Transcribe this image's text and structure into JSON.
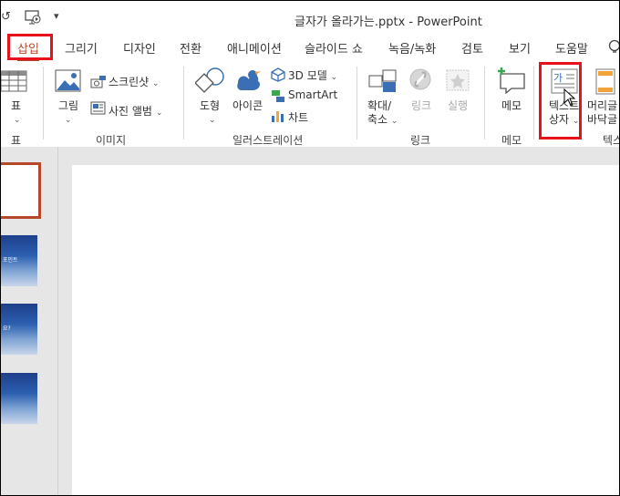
{
  "window": {
    "title": "글자가 올라가는.pptx  -  PowerPoint"
  },
  "tabs": [
    {
      "label": "삽입",
      "active": true
    },
    {
      "label": "그리기"
    },
    {
      "label": "디자인"
    },
    {
      "label": "전환"
    },
    {
      "label": "애니메이션"
    },
    {
      "label": "슬라이드 쇼"
    },
    {
      "label": "녹음/녹화"
    },
    {
      "label": "검토"
    },
    {
      "label": "보기"
    },
    {
      "label": "도움말"
    }
  ],
  "ribbon": {
    "table": {
      "button": "표",
      "group": "표"
    },
    "images": {
      "picture": "그림",
      "screenshot": "스크린샷",
      "album": "사진 앨범",
      "group": "이미지"
    },
    "illustrations": {
      "shapes": "도형",
      "icons": "아이콘",
      "model3d": "3D 모델",
      "smartart": "SmartArt",
      "chart": "차트",
      "group": "일러스트레이션"
    },
    "links": {
      "zoom_line1": "확대/",
      "zoom_line2": "축소",
      "link": "링크",
      "action": "실행",
      "group": "링크"
    },
    "comments": {
      "button": "메모",
      "group": "메모"
    },
    "text": {
      "textbox_line1": "텍스트",
      "textbox_line2": "상자",
      "textbox_icon_glyph": "가",
      "header_line1": "머리글",
      "header_line2": "바닥글",
      "group": "텍스"
    }
  },
  "slides": {
    "thumb2_text": "포인트",
    "thumb3_text": "요?"
  },
  "colors": {
    "accent": "#b7472a",
    "highlight": "#e8101a"
  }
}
